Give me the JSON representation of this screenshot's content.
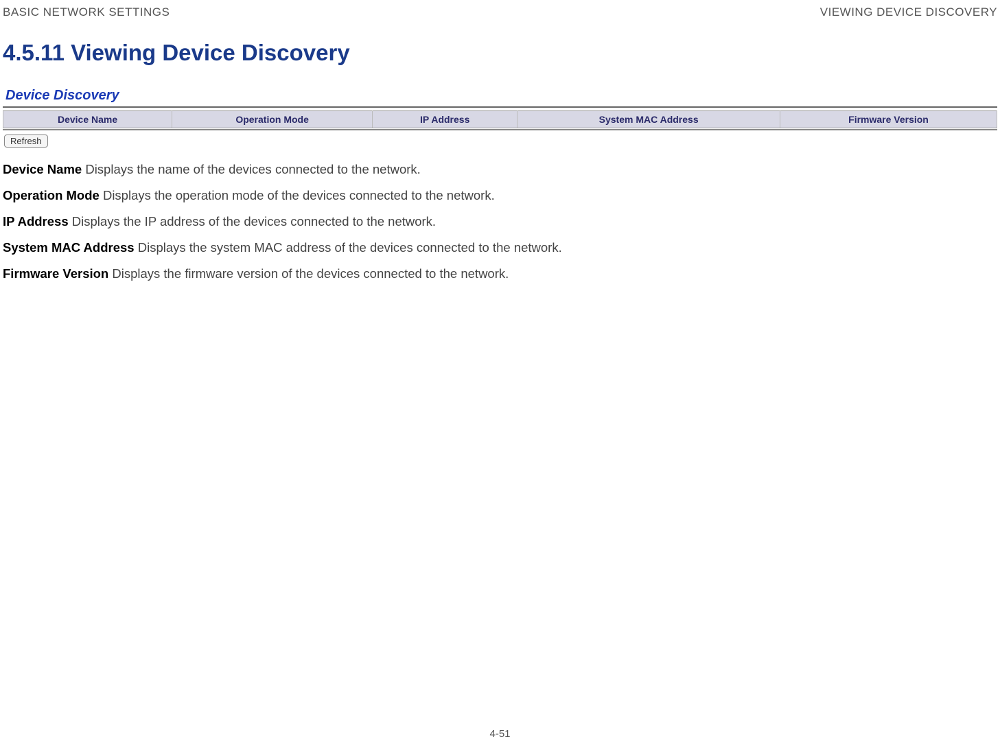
{
  "header": {
    "left": "BASIC NETWORK SETTINGS",
    "right": "VIEWING DEVICE DISCOVERY"
  },
  "heading": "4.5.11 Viewing Device Discovery",
  "panel": {
    "title": "Device Discovery",
    "columns": {
      "device_name": "Device Name",
      "operation_mode": "Operation Mode",
      "ip_address": "IP Address",
      "system_mac": "System MAC Address",
      "firmware_version": "Firmware Version"
    },
    "refresh_label": "Refresh"
  },
  "descriptions": [
    {
      "term": "Device Name",
      "text": "  Displays the name of the devices connected to the network."
    },
    {
      "term": "Operation Mode",
      "text": "  Displays the operation mode of the devices connected to the network."
    },
    {
      "term": "IP Address",
      "text": "  Displays the IP address of the devices connected to the network."
    },
    {
      "term": "System MAC Address",
      "text": "  Displays the system MAC address of the devices connected to the network."
    },
    {
      "term": "Firmware Version",
      "text": "  Displays the firmware version of the devices connected to the network."
    }
  ],
  "page_number": "4-51"
}
